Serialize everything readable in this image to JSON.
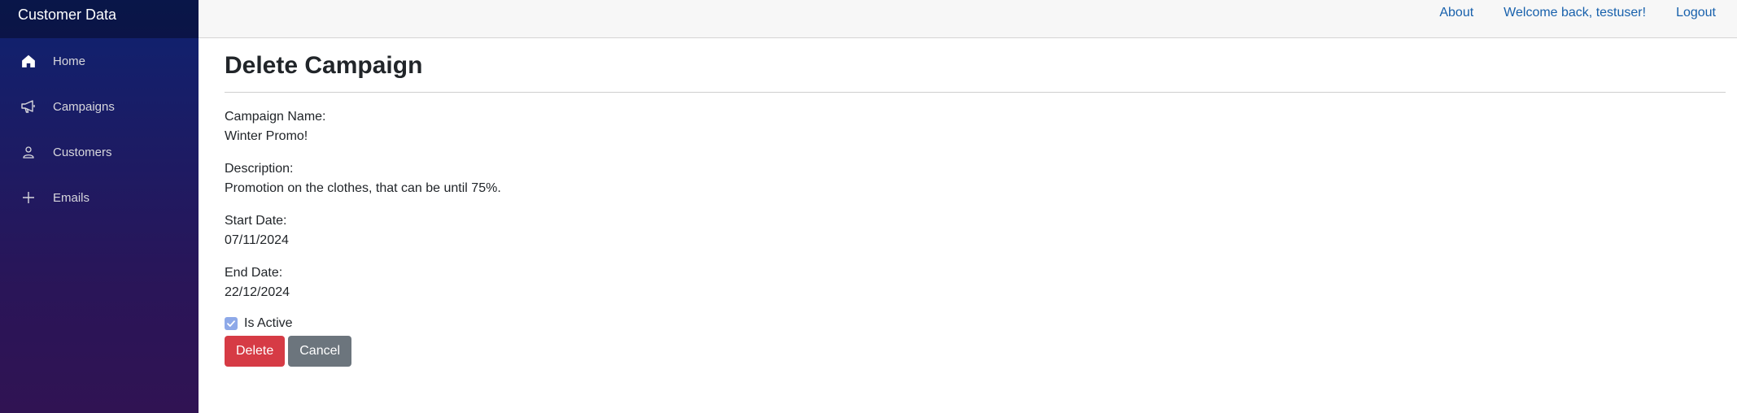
{
  "brand": {
    "title": "Customer Data"
  },
  "sidebar": {
    "items": [
      {
        "label": "Home",
        "icon": "home-icon"
      },
      {
        "label": "Campaigns",
        "icon": "megaphone-icon"
      },
      {
        "label": "Customers",
        "icon": "person-icon"
      },
      {
        "label": "Emails",
        "icon": "plus-icon"
      }
    ]
  },
  "topbar": {
    "about": "About",
    "welcome": "Welcome back, testuser!",
    "logout": "Logout"
  },
  "page": {
    "title": "Delete Campaign",
    "fields": [
      {
        "label": "Campaign Name:",
        "value": "Winter Promo!"
      },
      {
        "label": "Description:",
        "value": "Promotion on the clothes, that can be until 75%."
      },
      {
        "label": "Start Date:",
        "value": "07/11/2024"
      },
      {
        "label": "End Date:",
        "value": "22/12/2024"
      }
    ],
    "is_active_label": "Is Active",
    "is_active": true,
    "delete_label": "Delete",
    "cancel_label": "Cancel"
  },
  "colors": {
    "link": "#1861ac",
    "danger": "#d63b45",
    "secondary": "#6c757d",
    "sidebar_top": "#0e2270",
    "sidebar_bottom": "#301353"
  }
}
